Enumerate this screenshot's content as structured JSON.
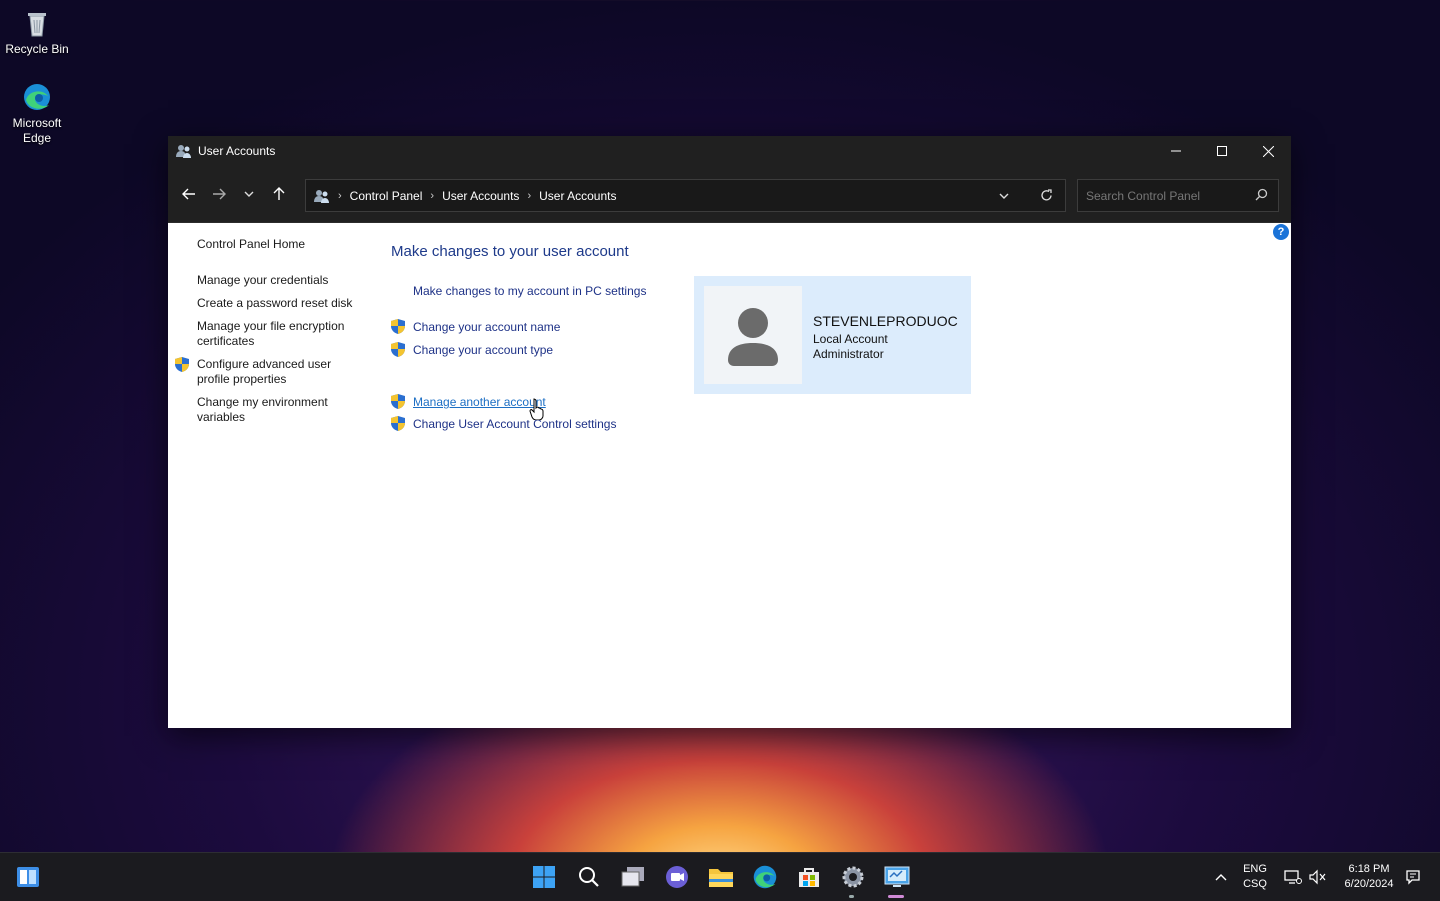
{
  "desktop": {
    "icons": [
      {
        "label": "Recycle Bin",
        "icon": "recycle-bin-icon"
      },
      {
        "label": "Microsoft Edge",
        "icon": "edge-icon"
      }
    ]
  },
  "window": {
    "title": "User Accounts",
    "breadcrumb": [
      "Control Panel",
      "User Accounts",
      "User Accounts"
    ],
    "search_placeholder": "Search Control Panel"
  },
  "sidebar": {
    "home": "Control Panel Home",
    "items": [
      "Manage your credentials",
      "Create a password reset disk",
      "Manage your file encryption certificates",
      "Configure advanced user profile properties",
      "Change my environment variables"
    ]
  },
  "main": {
    "heading": "Make changes to your user account",
    "pc_settings_link": "Make changes to my account in PC settings",
    "links": [
      "Change your account name",
      "Change your account type",
      "Manage another account",
      "Change User Account Control settings"
    ]
  },
  "account": {
    "name": "STEVENLEPRODUOC",
    "type": "Local Account",
    "role": "Administrator"
  },
  "taskbar": {
    "lang_top": "ENG",
    "lang_bottom": "CSQ",
    "time": "6:18 PM",
    "date": "6/20/2024"
  },
  "colors": {
    "link": "#1e3287",
    "heading": "#1e3a8a",
    "card": "#dcecfc",
    "titlebar": "#202020"
  }
}
